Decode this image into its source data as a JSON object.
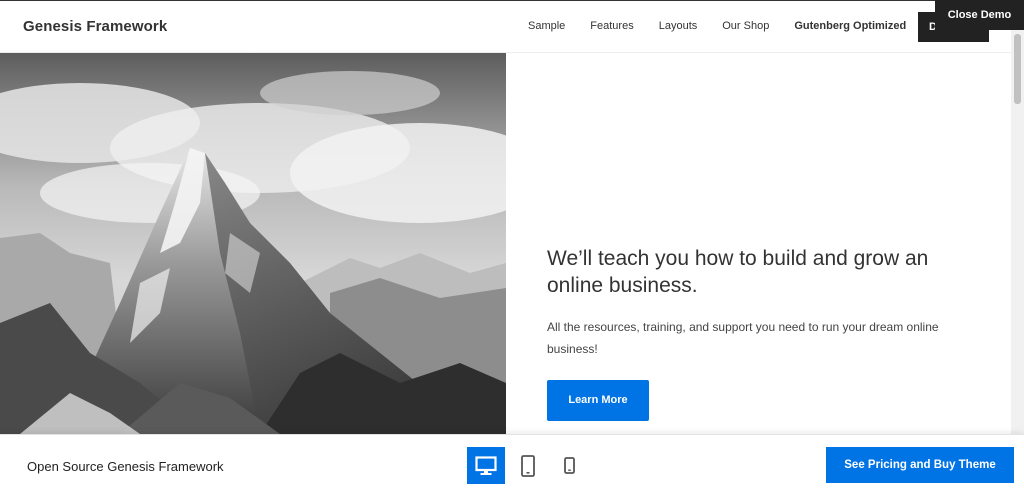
{
  "header": {
    "site_title": "Genesis Framework",
    "nav": [
      {
        "label": "Sample"
      },
      {
        "label": "Features"
      },
      {
        "label": "Layouts"
      },
      {
        "label": "Our Shop"
      },
      {
        "label": "Gutenberg Optimized"
      }
    ],
    "download_label": "D"
  },
  "close_demo_label": "Close Demo",
  "hero": {
    "image_icon": "mountain-photo",
    "title": "We’ll teach you how to build and grow an online business.",
    "text": "All the resources, training, and support you need to run your dream online business!",
    "button_label": "Learn More"
  },
  "demo_bar": {
    "theme_name": "Open Source Genesis Framework",
    "devices": [
      {
        "icon": "desktop-icon",
        "active": true
      },
      {
        "icon": "tablet-icon",
        "active": false
      },
      {
        "icon": "phone-icon",
        "active": false
      }
    ],
    "buy_label": "See Pricing and Buy Theme"
  },
  "colors": {
    "accent": "#0073e5",
    "dark": "#222222"
  }
}
